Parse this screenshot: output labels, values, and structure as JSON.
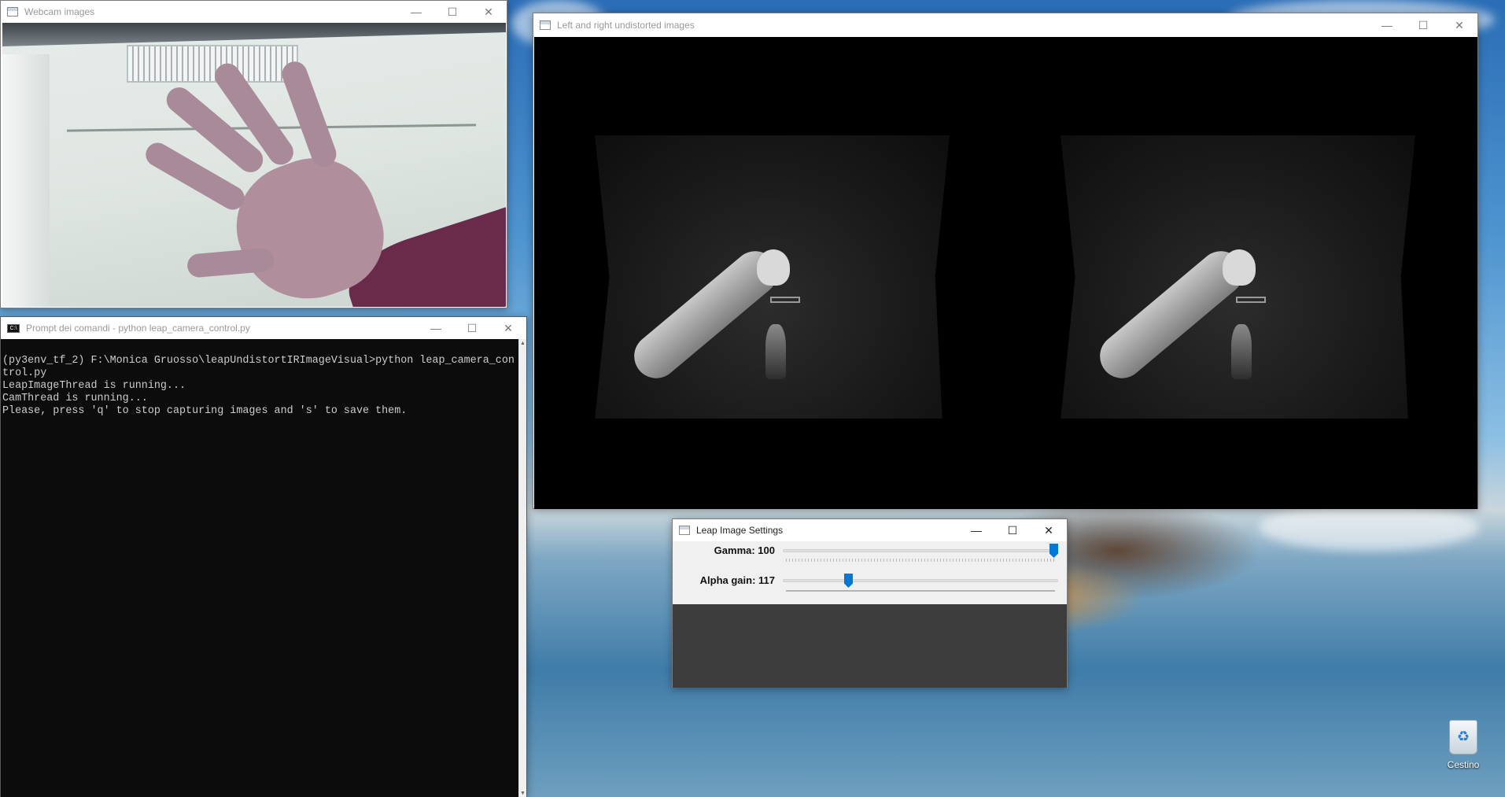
{
  "desktop": {
    "recycle_bin_label": "Cestino"
  },
  "webcam_window": {
    "title": "Webcam images",
    "icon": "window-app-icon"
  },
  "stereo_window": {
    "title": "Left and right undistorted images",
    "icon": "window-app-icon"
  },
  "cmd_window": {
    "title": "Prompt dei comandi - python  leap_camera_control.py",
    "icon": "console-icon",
    "lines": [
      "(py3env_tf_2) F:\\Monica Gruosso\\leapUndistortIRImageVisual>python leap_camera_control.py",
      "LeapImageThread is running...",
      "CamThread is running...",
      "Please, press 'q' to stop capturing images and 's' to save them."
    ]
  },
  "settings_window": {
    "title": "Leap Image Settings",
    "icon": "window-app-icon",
    "trackbars": [
      {
        "label": "Gamma: 100",
        "value": 100,
        "position": 1.0
      },
      {
        "label": "Alpha gain: 117",
        "value": 117,
        "position": 0.23
      }
    ]
  },
  "window_controls": {
    "minimize": "—",
    "maximize": "☐",
    "close": "✕"
  },
  "colors": {
    "console_bg": "#0c0c0c",
    "console_text": "#cccccc",
    "trackbar_thumb": "#0078d7",
    "settings_panel": "#3c3c3c"
  }
}
